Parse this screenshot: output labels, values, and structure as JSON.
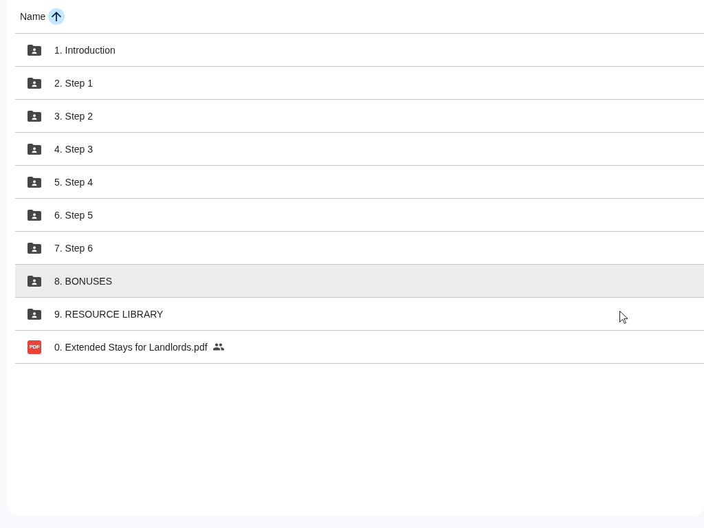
{
  "header": {
    "label": "Name",
    "ascending": true
  },
  "rows": [
    {
      "name": "1. Introduction",
      "kind": "shared_folder",
      "highlighted": false,
      "shared": false
    },
    {
      "name": "2. Step 1",
      "kind": "shared_folder",
      "highlighted": false,
      "shared": false
    },
    {
      "name": "3. Step 2",
      "kind": "shared_folder",
      "highlighted": false,
      "shared": false
    },
    {
      "name": "4. Step 3",
      "kind": "shared_folder",
      "highlighted": false,
      "shared": false
    },
    {
      "name": "5. Step 4",
      "kind": "shared_folder",
      "highlighted": false,
      "shared": false
    },
    {
      "name": "6. Step 5",
      "kind": "shared_folder",
      "highlighted": false,
      "shared": false
    },
    {
      "name": "7. Step 6",
      "kind": "shared_folder",
      "highlighted": false,
      "shared": false
    },
    {
      "name": "8. BONUSES",
      "kind": "shared_folder",
      "highlighted": true,
      "shared": false
    },
    {
      "name": "9. RESOURCE LIBRARY",
      "kind": "shared_folder",
      "highlighted": false,
      "shared": false
    },
    {
      "name": "0. Extended Stays for Landlords.pdf",
      "kind": "pdf",
      "badge": "PDF",
      "highlighted": false,
      "shared": true
    }
  ]
}
